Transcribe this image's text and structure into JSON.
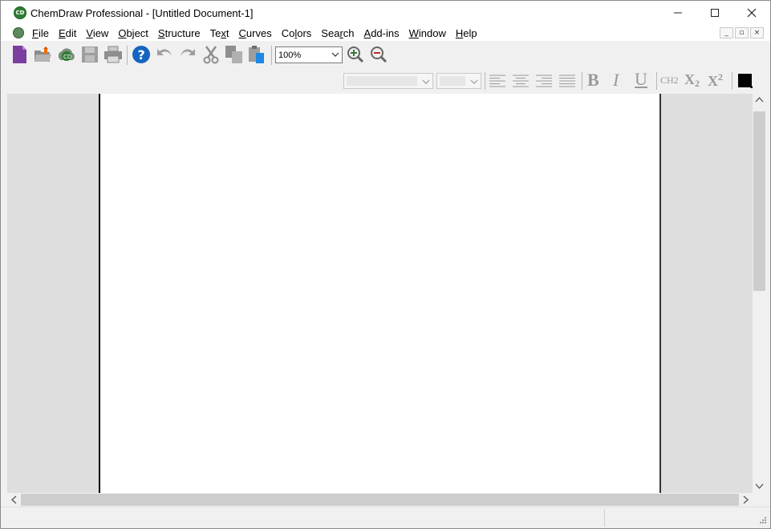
{
  "window": {
    "title": "ChemDraw Professional - [Untitled Document-1]",
    "app_icon_text": "CD",
    "controls": {
      "minimize": "—",
      "maximize": "☐",
      "close": "✕"
    }
  },
  "menubar": {
    "items": [
      {
        "label": "File",
        "access_key": "F"
      },
      {
        "label": "Edit",
        "access_key": "E"
      },
      {
        "label": "View",
        "access_key": "V"
      },
      {
        "label": "Object",
        "access_key": "O"
      },
      {
        "label": "Structure",
        "access_key": "S"
      },
      {
        "label": "Text",
        "access_key": "x"
      },
      {
        "label": "Curves",
        "access_key": "C"
      },
      {
        "label": "Colors",
        "access_key": "l"
      },
      {
        "label": "Search",
        "access_key": "r"
      },
      {
        "label": "Add-ins",
        "access_key": "A"
      },
      {
        "label": "Window",
        "access_key": "W"
      },
      {
        "label": "Help",
        "access_key": "H"
      }
    ],
    "mdi_controls": {
      "minimize": "_",
      "restore": "▫",
      "close": "×"
    }
  },
  "toolbar": {
    "zoom_value": "100%",
    "icons": [
      "new-document-icon",
      "open-icon",
      "open-cloud-icon",
      "save-icon",
      "print-icon",
      "help-icon",
      "undo-icon",
      "redo-icon",
      "cut-icon",
      "copy-icon",
      "paste-icon",
      "zoom-in-icon",
      "zoom-out-icon"
    ]
  },
  "format_toolbar": {
    "font_value": "",
    "size_value": "",
    "bold": "B",
    "italic": "I",
    "underline": "U",
    "formula": "CH2",
    "subscript_base": "X",
    "subscript_digit": "2",
    "superscript_base": "X",
    "superscript_digit": "2",
    "text_color": "#000000"
  },
  "colors": {
    "window_bg": "#f0f0f0",
    "page_bg": "#ffffff",
    "workspace_bg": "#dedede",
    "scroll_thumb": "#cdcdcd",
    "accent_purple": "#7b3fa0",
    "accent_help": "#1565c0"
  }
}
